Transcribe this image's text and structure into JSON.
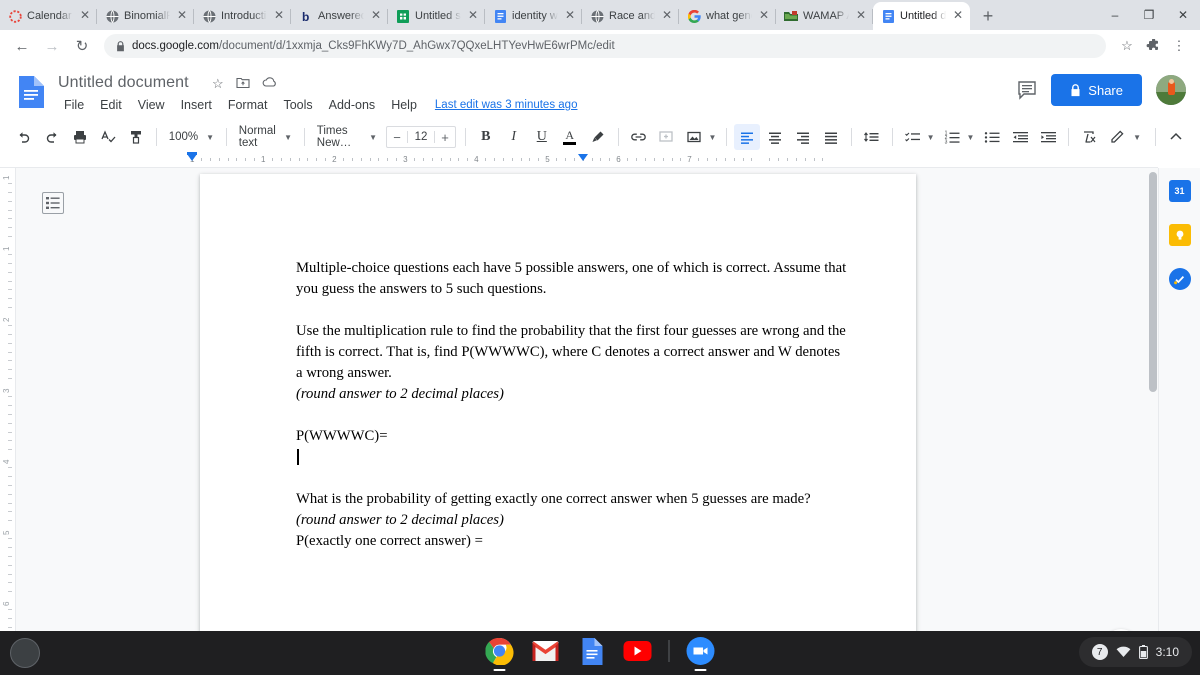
{
  "browser": {
    "tabs": [
      {
        "label": "Calendar",
        "favicon": "calendar-icon",
        "active": false
      },
      {
        "label": "BinomialP",
        "favicon": "globe-icon",
        "active": false
      },
      {
        "label": "Introducti",
        "favicon": "globe-icon",
        "active": false
      },
      {
        "label": "Answered",
        "favicon": "bartleby-icon",
        "active": false
      },
      {
        "label": "Untitled sp",
        "favicon": "sheets-icon",
        "active": false
      },
      {
        "label": "identity w",
        "favicon": "docs-icon",
        "active": false
      },
      {
        "label": "Race and",
        "favicon": "globe-icon",
        "active": false
      },
      {
        "label": "what gene",
        "favicon": "google-icon",
        "active": false
      },
      {
        "label": "WAMAP A",
        "favicon": "wamap-icon",
        "active": false
      },
      {
        "label": "Untitled d",
        "favicon": "docs-icon",
        "active": true
      }
    ],
    "new_tab_label": "+",
    "window_controls": {
      "minimize": "–",
      "maximize": "❐",
      "close": "✕"
    },
    "nav": {
      "back": "←",
      "forward": "→",
      "reload": "↻"
    },
    "url": {
      "lock_icon": "lock-icon",
      "domain": "docs.google.com",
      "path": "/document/d/1xxmja_Cks9FhKWy7D_AhGwx7QQxeLHTYevHwE6wrPMc/edit"
    },
    "omni_actions": {
      "bookmark": "☆",
      "extensions": "extensions-icon",
      "menu": "⋮"
    }
  },
  "docs": {
    "title": "Untitled document",
    "title_icons": [
      "star-icon",
      "move-to-folder-icon",
      "cloud-saved-icon"
    ],
    "menus": [
      "File",
      "Edit",
      "View",
      "Insert",
      "Format",
      "Tools",
      "Add-ons",
      "Help"
    ],
    "last_edit": "Last edit was 3 minutes ago",
    "comment_icon": "comment-history-icon",
    "share_label": "Share",
    "share_lock_icon": "lock-icon",
    "share_color": "#1a73e8",
    "avatar": "user-avatar"
  },
  "toolbar": {
    "undo": "undo-icon",
    "redo": "redo-icon",
    "print": "print-icon",
    "spellcheck": "spellcheck-icon",
    "paint_format": "paint-format-icon",
    "zoom": "100%",
    "style": "Normal text",
    "font": "Times New…",
    "font_size": "12",
    "decrease_label": "−",
    "increase_label": "+",
    "bold": "B",
    "italic": "I",
    "underline": "U",
    "text_color": "A",
    "highlight": "highlight-icon",
    "link": "link-icon",
    "comment": "add-comment-icon",
    "image": "insert-image-icon",
    "align_left": "align-left-icon",
    "align_center": "align-center-icon",
    "align_right": "align-right-icon",
    "align_justify": "align-justify-icon",
    "line_spacing": "line-spacing-icon",
    "checklist": "checklist-icon",
    "numbered_list": "numbered-list-icon",
    "bulleted_list": "bulleted-list-icon",
    "decrease_indent": "decrease-indent-icon",
    "increase_indent": "increase-indent-icon",
    "clear_formatting": "clear-formatting-icon",
    "editing_mode": "editing-pencil-icon",
    "collapse": "collapse-toolbar-icon"
  },
  "ruler": {
    "marks": [
      "1",
      "1",
      "2",
      "3",
      "4",
      "5",
      "6",
      "7"
    ],
    "left_indent_in": 1,
    "right_indent_in": 6.5
  },
  "document": {
    "outline_icon": "document-outline-icon",
    "paragraphs": [
      {
        "type": "text",
        "text": "Multiple-choice questions each have 5 possible answers, one of which is correct. Assume that you guess the answers to 5 such questions."
      },
      {
        "type": "blank"
      },
      {
        "type": "text",
        "text": "Use the multiplication rule to find the probability that the first four guesses are wrong and the fifth is correct. That is, find P(WWWWC), where C denotes a correct answer and W denotes a wrong answer."
      },
      {
        "type": "italic",
        "text": "(round answer to 2 decimal places)"
      },
      {
        "type": "blank"
      },
      {
        "type": "text",
        "text": "P(WWWWC)="
      },
      {
        "type": "caret"
      },
      {
        "type": "blank"
      },
      {
        "type": "text",
        "text": "What is the probability of getting exactly one correct answer when 5 guesses are made?"
      },
      {
        "type": "italic",
        "text": "(round answer to 2 decimal places)"
      },
      {
        "type": "text",
        "text": "P(exactly one correct answer) ="
      }
    ]
  },
  "rail": {
    "icons": [
      {
        "name": "google-calendar-icon",
        "label": "31",
        "color": "#1a73e8"
      },
      {
        "name": "google-keep-icon",
        "label": "",
        "color": "#fbbc04"
      },
      {
        "name": "google-tasks-icon",
        "label": "",
        "color": "#1a73e8"
      }
    ],
    "expand": "›",
    "explore_icon": "explore-icon"
  },
  "shelf": {
    "launcher": "launcher-button",
    "apps": [
      {
        "name": "chrome-icon",
        "running": true
      },
      {
        "name": "gmail-icon",
        "running": false
      },
      {
        "name": "google-docs-icon",
        "running": false
      },
      {
        "name": "youtube-icon",
        "running": false
      },
      {
        "name": "zoom-icon",
        "running": true
      }
    ],
    "tray": {
      "notification_count": "7",
      "wifi_icon": "wifi-icon",
      "battery_icon": "battery-icon",
      "time": "3:10"
    }
  }
}
